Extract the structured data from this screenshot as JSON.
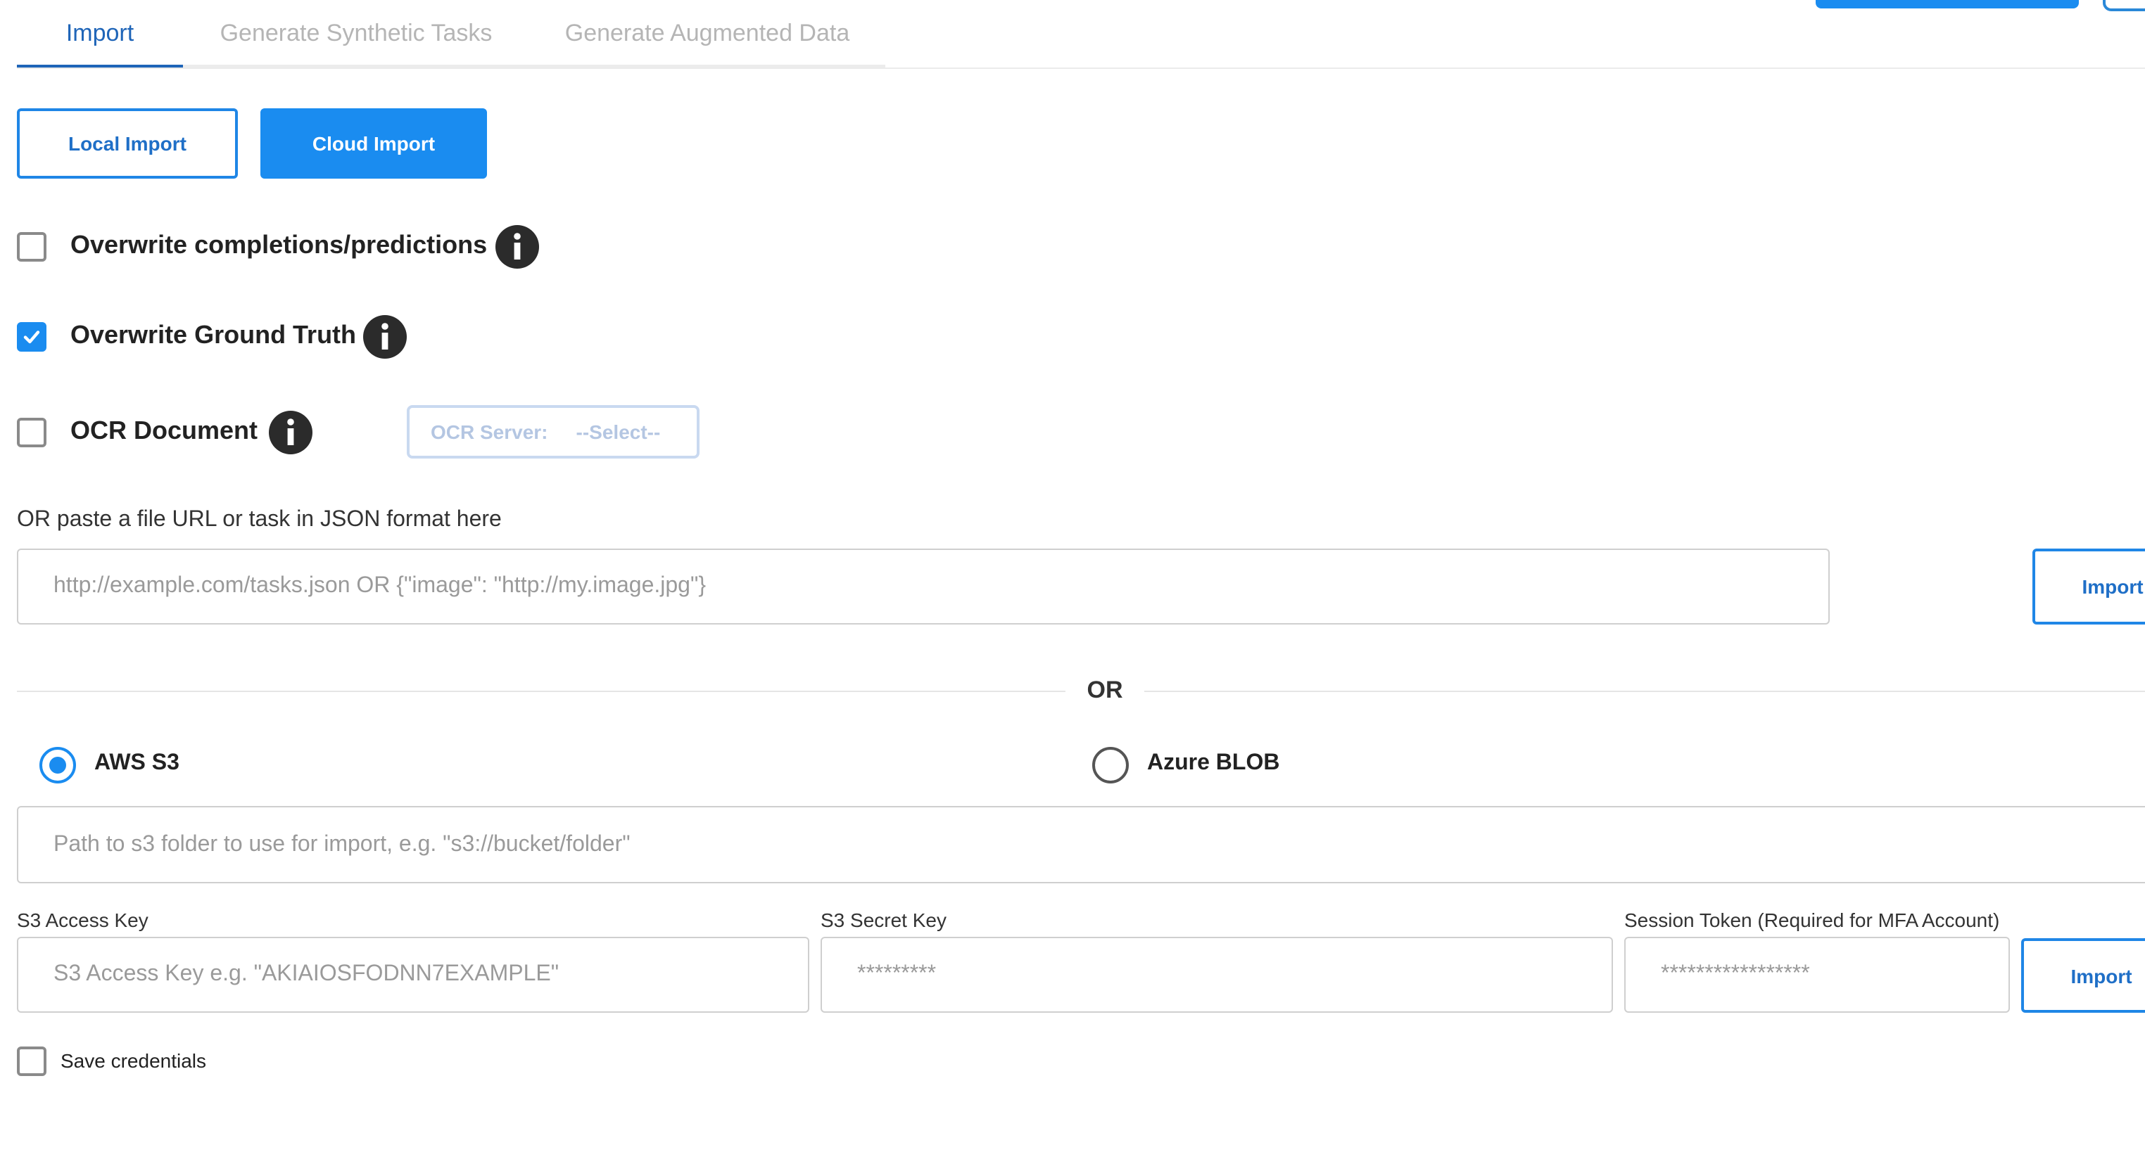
{
  "tabs": [
    {
      "label": "Import",
      "active": true
    },
    {
      "label": "Generate Synthetic Tasks",
      "active": false
    },
    {
      "label": "Generate Augmented Data",
      "active": false
    }
  ],
  "import_mode": {
    "local_label": "Local Import",
    "cloud_label": "Cloud Import",
    "selected": "Cloud Import"
  },
  "options": {
    "overwrite_completions": {
      "label": "Overwrite completions/predictions",
      "checked": false
    },
    "overwrite_ground_truth": {
      "label": "Overwrite Ground Truth",
      "checked": true
    },
    "ocr_document": {
      "label": "OCR Document",
      "checked": false
    }
  },
  "ocr_server": {
    "label": "OCR Server:",
    "value": "--Select--"
  },
  "url_import": {
    "label": "OR paste a file URL or task in JSON format here",
    "placeholder": "http://example.com/tasks.json OR {\"image\": \"http://my.image.jpg\"}",
    "value": "",
    "button_label": "Import"
  },
  "separator_text": "OR",
  "storage": {
    "aws_label": "AWS S3",
    "azure_label": "Azure BLOB",
    "selected": "AWS S3"
  },
  "s3": {
    "path_placeholder": "Path to s3 folder to use for import, e.g. \"s3://bucket/folder\"",
    "access_key_label": "S3 Access Key",
    "access_key_placeholder": "S3 Access Key e.g. \"AKIAIOSFODNN7EXAMPLE\"",
    "secret_key_label": "S3 Secret Key",
    "secret_key_placeholder": "*********",
    "session_token_label": "Session Token (Required for MFA Account)",
    "session_token_placeholder": "*****************",
    "import_button_label": "Import"
  },
  "save_credentials": {
    "label": "Save credentials",
    "checked": false
  },
  "colors": {
    "accent": "#1a8cf0",
    "tab_active": "#1f65b8",
    "tab_inactive": "#b5b5b5",
    "info_icon": "#2b2b2b"
  },
  "icons": {
    "info": "info-circle-icon",
    "check": "checkmark-icon"
  }
}
